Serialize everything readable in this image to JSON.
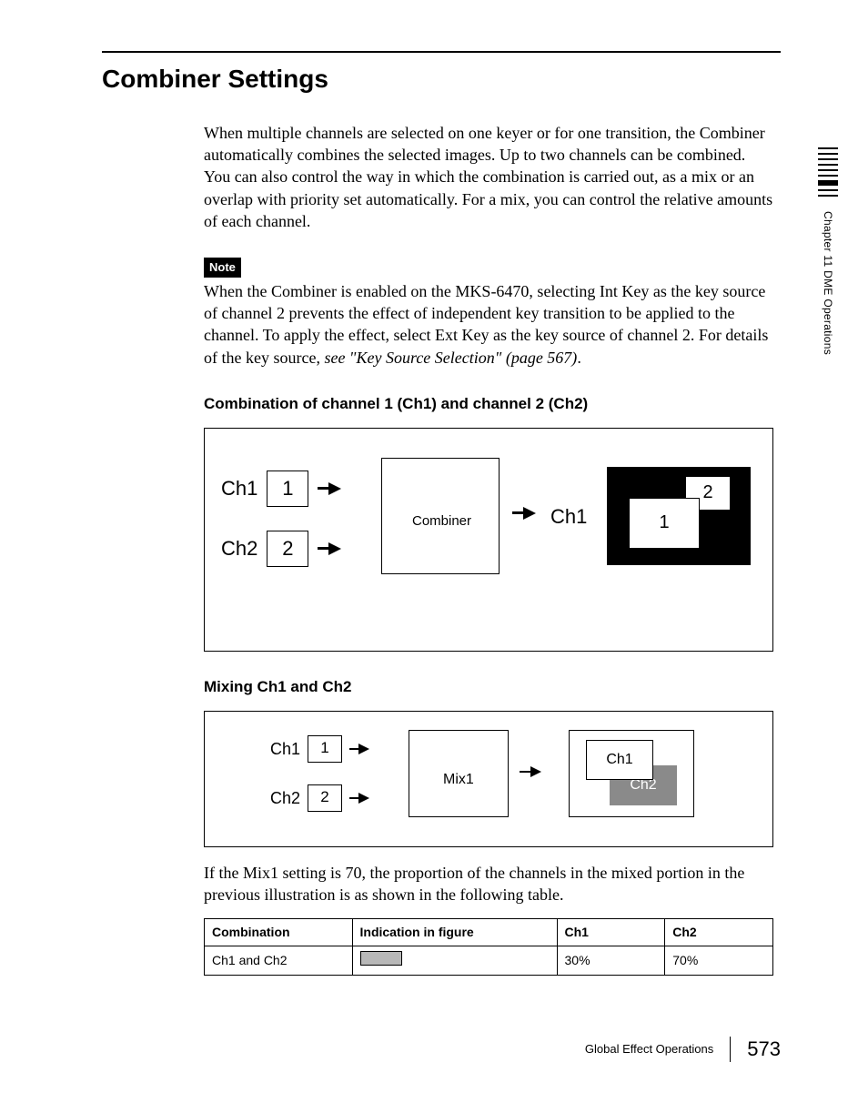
{
  "sidebar": {
    "chapter": "Chapter 11  DME Operations"
  },
  "title": "Combiner Settings",
  "intro1": "When multiple channels are selected on one keyer or for one transition, the Combiner automatically combines the selected images. Up to two channels can be combined.",
  "intro2": "You can also control the way in which the combination is carried out, as a mix or an overlap with priority set automatically. For a mix, you can control the relative amounts of each channel.",
  "note_label": "Note",
  "note_text_a": "When the Combiner is enabled on the MKS-6470, selecting Int Key as the key source of channel 2 prevents the effect of independent key transition to be applied to the channel. To apply the effect, select Ext Key as the key source of channel 2. For details of the key source, ",
  "note_text_b": "see \"Key Source Selection\" (page 567)",
  "note_text_c": ".",
  "sub1": "Combination of channel 1 (Ch1) and channel 2 (Ch2)",
  "fig1": {
    "ch1_label": "Ch1",
    "ch1_num": "1",
    "ch2_label": "Ch2",
    "ch2_num": "2",
    "combiner": "Combiner",
    "out": "Ch1",
    "res1": "1",
    "res2": "2"
  },
  "sub2": "Mixing Ch1 and Ch2",
  "fig2": {
    "ch1_label": "Ch1",
    "ch1_num": "1",
    "ch2_label": "Ch2",
    "ch2_num": "2",
    "mix": "Mix1",
    "res_ch1": "Ch1",
    "res_ch2": "Ch2"
  },
  "after_fig2": "If the Mix1 setting is 70, the proportion of the channels in the mixed portion in the previous illustration is as shown in the following table.",
  "table": {
    "headers": {
      "c0": "Combination",
      "c1": "Indication in figure",
      "c2": "Ch1",
      "c3": "Ch2"
    },
    "row": {
      "c0": "Ch1 and Ch2",
      "c2": "30%",
      "c3": "70%"
    }
  },
  "footer": {
    "section": "Global Effect Operations",
    "page": "573"
  }
}
